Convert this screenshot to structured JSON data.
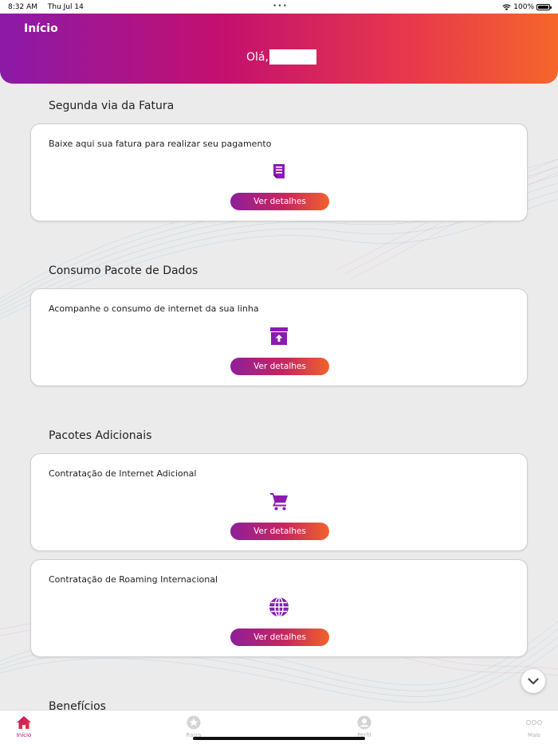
{
  "status_bar": {
    "time": "8:32 AM",
    "date": "Thu Jul 14",
    "battery": "100%",
    "battery_level": 1.0
  },
  "header": {
    "title": "Início",
    "greeting": "Olá,"
  },
  "sections": [
    {
      "title": "Segunda via da Fatura"
    },
    {
      "title": "Consumo Pacote de Dados"
    },
    {
      "title": "Pacotes Adicionais"
    },
    {
      "title": "Benefícios"
    }
  ],
  "cards": [
    {
      "description": "Baixe aqui sua fatura para realizar seu pagamento",
      "icon": "invoice-icon",
      "button": "Ver detalhes"
    },
    {
      "description": "Acompanhe o consumo de internet da sua linha",
      "icon": "box-upload-icon",
      "button": "Ver detalhes"
    },
    {
      "description": "Contratação de Internet Adicional",
      "icon": "cart-icon",
      "button": "Ver detalhes"
    },
    {
      "description": "Contratação de Roaming Internacional",
      "icon": "globe-icon",
      "button": "Ver detalhes"
    }
  ],
  "tabs": [
    {
      "label": "Início",
      "icon": "home-icon",
      "active": true
    },
    {
      "label": "Raiza",
      "icon": "star-icon",
      "active": false
    },
    {
      "label": "Perfil",
      "icon": "profile-icon",
      "active": false
    },
    {
      "label": "Mais",
      "icon": "more-icon",
      "active": false
    }
  ],
  "colors": {
    "accent_purple": "#8e1f9a",
    "accent_orange": "#f0622c",
    "icon_purple": "#8a1cb0",
    "active_tab": "#b0127a"
  }
}
